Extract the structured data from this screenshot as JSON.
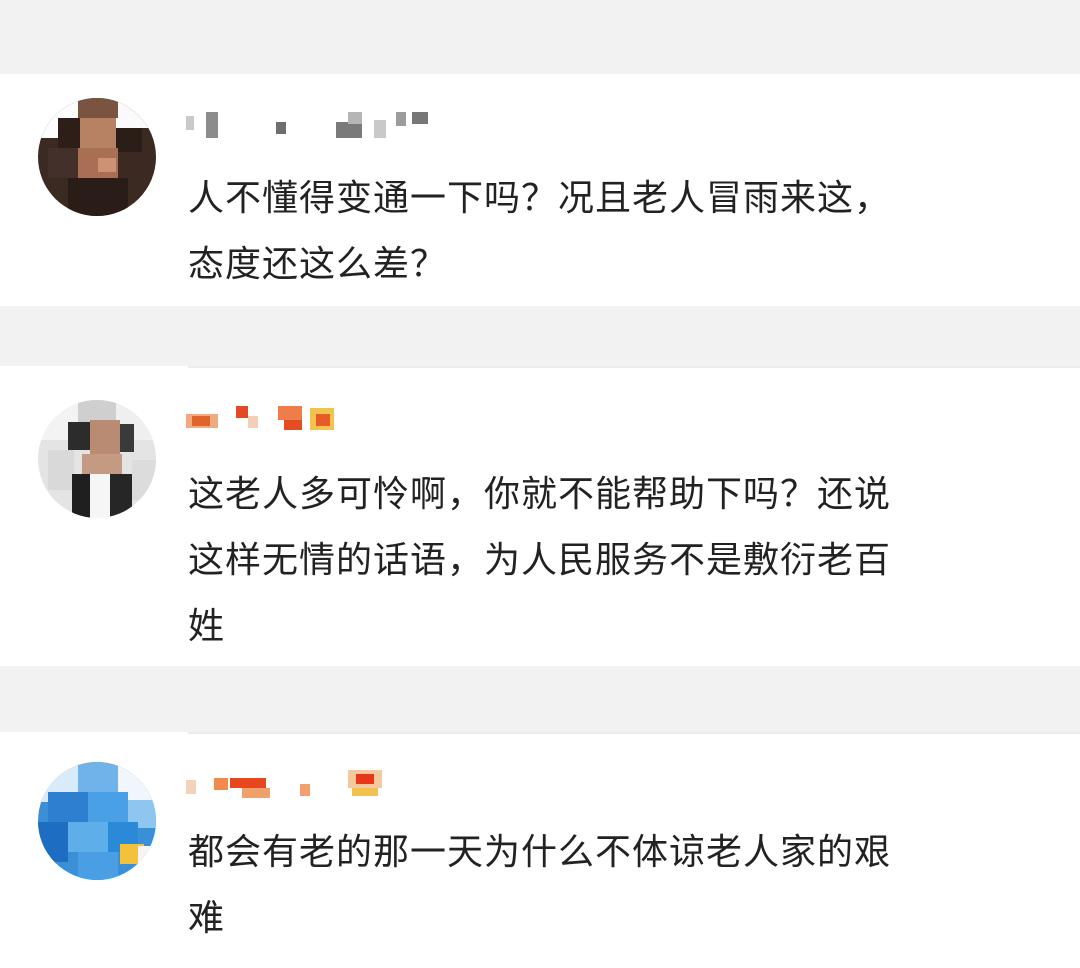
{
  "comments": [
    {
      "username": "",
      "text": "人不懂得变通一下吗？况且老人冒雨来这，\n态度还这么差？"
    },
    {
      "username": "",
      "text": "这老人多可怜啊，你就不能帮助下吗？还说\n这样无情的话语，为人民服务不是敷衍老百\n姓"
    },
    {
      "username": "",
      "text": "都会有老的那一天为什么不体谅老人家的艰\n难"
    }
  ],
  "colors": {
    "background": "#f2f2f2",
    "card": "#ffffff",
    "text": "#222222"
  }
}
